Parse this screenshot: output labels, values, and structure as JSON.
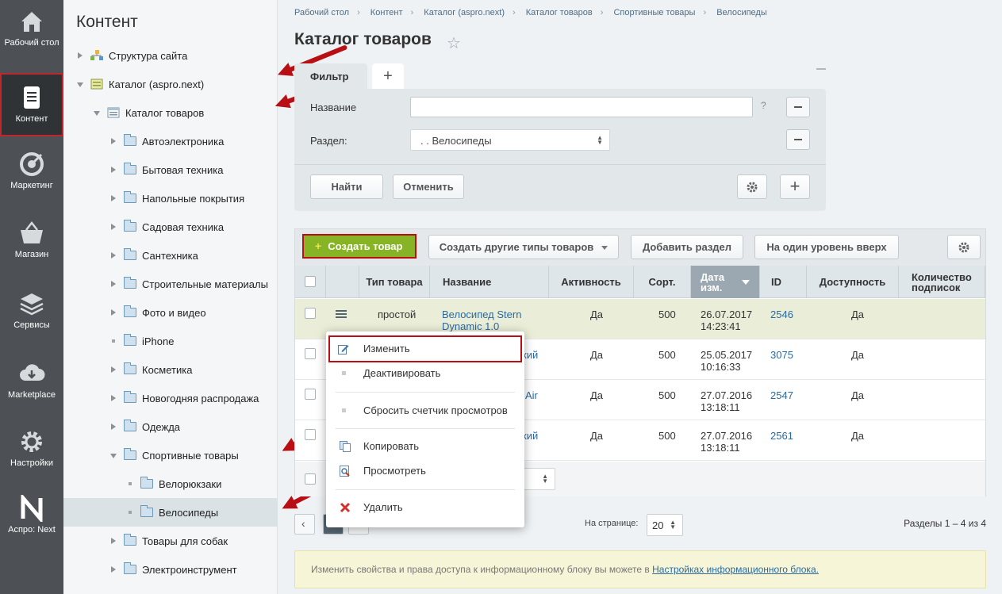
{
  "left_menu": [
    {
      "label": "Рабочий стол",
      "icon": "home-icon"
    },
    {
      "label": "Контент",
      "icon": "document-icon",
      "active": true
    },
    {
      "label": "Маркетинг",
      "icon": "target-icon"
    },
    {
      "label": "Магазин",
      "icon": "basket-icon"
    },
    {
      "label": "Сервисы",
      "icon": "layers-icon"
    },
    {
      "label": "Marketplace",
      "icon": "cloud-download-icon"
    },
    {
      "label": "Настройки",
      "icon": "gear-icon"
    },
    {
      "label": "Аспро: Next",
      "icon": "aspro-logo-icon"
    }
  ],
  "tree": {
    "title": "Контент",
    "items": [
      {
        "label": "Структура сайта"
      },
      {
        "label": "Каталог (aspro.next)"
      },
      {
        "label": "Каталог товаров"
      },
      {
        "label": "Автоэлектроника"
      },
      {
        "label": "Бытовая техника"
      },
      {
        "label": "Напольные покрытия"
      },
      {
        "label": "Садовая техника"
      },
      {
        "label": "Сантехника"
      },
      {
        "label": "Строительные материалы"
      },
      {
        "label": "Фото и видео"
      },
      {
        "label": "iPhone"
      },
      {
        "label": "Косметика"
      },
      {
        "label": "Новогодняя распродажа"
      },
      {
        "label": "Одежда"
      },
      {
        "label": "Спортивные товары"
      },
      {
        "label": "Велорюкзаки"
      },
      {
        "label": "Велосипеды"
      },
      {
        "label": "Товары для собак"
      },
      {
        "label": "Электроинструмент"
      }
    ]
  },
  "breadcrumb": [
    "Рабочий стол",
    "Контент",
    "Каталог (aspro.next)",
    "Каталог товаров",
    "Спортивные товары",
    "Велосипеды"
  ],
  "page_title": "Каталог товаров",
  "filter": {
    "tab": "Фильтр",
    "name_label": "Название",
    "name_value": "",
    "help": "?",
    "section_label": "Раздел:",
    "section_value": ". . Велосипеды",
    "find_label": "Найти",
    "cancel_label": "Отменить"
  },
  "toolbar": {
    "create_label": "Создать товар",
    "create_other_label": "Создать другие типы товаров",
    "add_section_label": "Добавить раздел",
    "level_up_label": "На один уровень вверх"
  },
  "table": {
    "columns": [
      "Тип товара",
      "Название",
      "Активность",
      "Сорт.",
      "Дата изм.",
      "ID",
      "Доступность",
      "Количество подписок"
    ],
    "rows": [
      {
        "type": "простой",
        "name": "Велосипед Stern Dynamic 1.0",
        "active": "Да",
        "sort": "500",
        "date": "26.07.2017",
        "time": "14:23:41",
        "id": "2546",
        "avail": "Да"
      },
      {
        "type": "",
        "name": "кий",
        "active": "Да",
        "sort": "500",
        "date": "25.05.2017",
        "time": "10:16:33",
        "id": "3075",
        "avail": "Да"
      },
      {
        "type": "",
        "name": "Air",
        "active": "Да",
        "sort": "500",
        "date": "27.07.2016",
        "time": "13:18:11",
        "id": "2547",
        "avail": "Да"
      },
      {
        "type": "",
        "name": "кий",
        "active": "Да",
        "sort": "500",
        "date": "27.07.2016",
        "time": "13:18:11",
        "id": "2561",
        "avail": "Да"
      }
    ]
  },
  "pager": {
    "per_page_label": "На странице:",
    "per_page_value": "20",
    "total": "Разделы 1 – 4 из 4"
  },
  "notice": {
    "text": "Изменить свойства и права доступа к информационному блоку вы можете в",
    "link": "Настройках информационного блока."
  },
  "context_menu": {
    "edit": "Изменить",
    "deactivate": "Деактивировать",
    "reset_counter": "Сбросить счетчик просмотров",
    "copy": "Копировать",
    "view": "Просмотреть",
    "delete": "Удалить"
  }
}
